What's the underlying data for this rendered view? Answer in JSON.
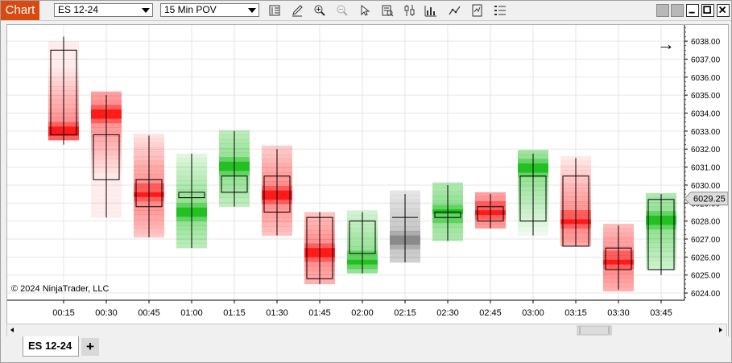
{
  "toolbar": {
    "window_tag": "Chart",
    "instrument": "ES 12-24",
    "interval": "15 Min POV"
  },
  "chart": {
    "copyright": "© 2024 NinjaTrader, LLC",
    "current_price": "6029.25",
    "nav_arrow": "→"
  },
  "tabs": [
    {
      "label": "ES 12-24"
    }
  ],
  "add_tab_label": "+",
  "chart_data": {
    "type": "candlestick_volume_profile",
    "instrument": "ES 12-24",
    "interval": "15 Min POV",
    "x_labels": [
      "00:15",
      "00:30",
      "00:45",
      "01:00",
      "01:15",
      "01:30",
      "01:45",
      "02:00",
      "02:15",
      "02:30",
      "02:45",
      "03:00",
      "03:15",
      "03:30",
      "03:45"
    ],
    "y_ticks": [
      "6038.00",
      "6037.00",
      "6036.00",
      "6035.00",
      "6034.00",
      "6033.00",
      "6032.00",
      "6031.00",
      "6030.00",
      "6029.00",
      "6028.00",
      "6027.00",
      "6026.00",
      "6025.00",
      "6024.00"
    ],
    "ylim": [
      6023.6,
      6038.9
    ],
    "current_price": 6029.25,
    "bars": [
      {
        "time": "00:15",
        "dir": "down",
        "open": 6037.5,
        "close": 6032.8,
        "high": 6038.25,
        "low": 6032.25,
        "poc": 6033.0,
        "vlo": 6032.5,
        "vhi": 6038.0
      },
      {
        "time": "00:30",
        "dir": "down",
        "open": 6032.8,
        "close": 6030.3,
        "high": 6035.0,
        "low": 6028.2,
        "poc": 6034.0,
        "vlo": 6028.2,
        "vhi": 6035.0
      },
      {
        "time": "00:45",
        "dir": "down",
        "open": 6030.3,
        "close": 6028.8,
        "high": 6032.75,
        "low": 6027.1,
        "poc": 6029.5,
        "vlo": 6027.1,
        "vhi": 6032.75
      },
      {
        "time": "01:00",
        "dir": "up",
        "open": 6029.3,
        "close": 6029.6,
        "high": 6031.75,
        "low": 6026.5,
        "poc": 6028.5,
        "vlo": 6026.5,
        "vhi": 6031.6
      },
      {
        "time": "01:15",
        "dir": "up",
        "open": 6029.6,
        "close": 6030.5,
        "high": 6033.0,
        "low": 6028.8,
        "poc": 6031.0,
        "vlo": 6028.8,
        "vhi": 6033.0
      },
      {
        "time": "01:30",
        "dir": "down",
        "open": 6030.5,
        "close": 6028.5,
        "high": 6032.0,
        "low": 6027.2,
        "poc": 6029.5,
        "vlo": 6027.2,
        "vhi": 6032.0
      },
      {
        "time": "01:45",
        "dir": "down",
        "open": 6028.2,
        "close": 6024.8,
        "high": 6028.5,
        "low": 6024.5,
        "poc": 6026.25,
        "vlo": 6024.5,
        "vhi": 6028.5
      },
      {
        "time": "02:00",
        "dir": "up",
        "open": 6026.2,
        "close": 6028.0,
        "high": 6028.5,
        "low": 6025.1,
        "poc": 6025.75,
        "vlo": 6025.1,
        "vhi": 6028.4
      },
      {
        "time": "02:15",
        "dir": "flat",
        "open": 6028.2,
        "close": 6028.2,
        "high": 6029.5,
        "low": 6025.7,
        "poc": 6027.0,
        "vlo": 6025.7,
        "vhi": 6029.5
      },
      {
        "time": "02:30",
        "dir": "up",
        "open": 6028.2,
        "close": 6028.5,
        "high": 6030.0,
        "low": 6026.9,
        "poc": 6028.5,
        "vlo": 6026.9,
        "vhi": 6030.0
      },
      {
        "time": "02:45",
        "dir": "down",
        "open": 6028.8,
        "close": 6028.0,
        "high": 6029.5,
        "low": 6027.6,
        "poc": 6028.5,
        "vlo": 6027.6,
        "vhi": 6029.5
      },
      {
        "time": "03:00",
        "dir": "up",
        "open": 6028.0,
        "close": 6030.5,
        "high": 6031.75,
        "low": 6027.2,
        "poc": 6031.0,
        "vlo": 6027.2,
        "vhi": 6031.75
      },
      {
        "time": "03:15",
        "dir": "down",
        "open": 6030.5,
        "close": 6026.6,
        "high": 6031.5,
        "low": 6026.6,
        "poc": 6028.0,
        "vlo": 6026.6,
        "vhi": 6031.5
      },
      {
        "time": "03:30",
        "dir": "down",
        "open": 6026.5,
        "close": 6025.3,
        "high": 6027.75,
        "low": 6024.2,
        "poc": 6025.75,
        "vlo": 6024.1,
        "vhi": 6027.75
      },
      {
        "time": "03:45",
        "dir": "up",
        "open": 6025.3,
        "close": 6029.2,
        "high": 6029.5,
        "low": 6025.0,
        "poc": 6028.0,
        "vlo": 6025.3,
        "vhi": 6029.5
      }
    ]
  },
  "colors": {
    "window_tag_bg": "#d94a10",
    "up": "#22c022",
    "down": "#ff1a1a",
    "flat": "#8a8a8a",
    "price_badge_bg": "#dddddd"
  },
  "icons": [
    "data-series-icon",
    "pencil-icon",
    "zoom-in-icon",
    "zoom-out-icon",
    "pointer-icon",
    "properties-icon",
    "chart-style-icon",
    "volume-icon",
    "indicator-icon",
    "strategy-icon",
    "list-icon"
  ]
}
